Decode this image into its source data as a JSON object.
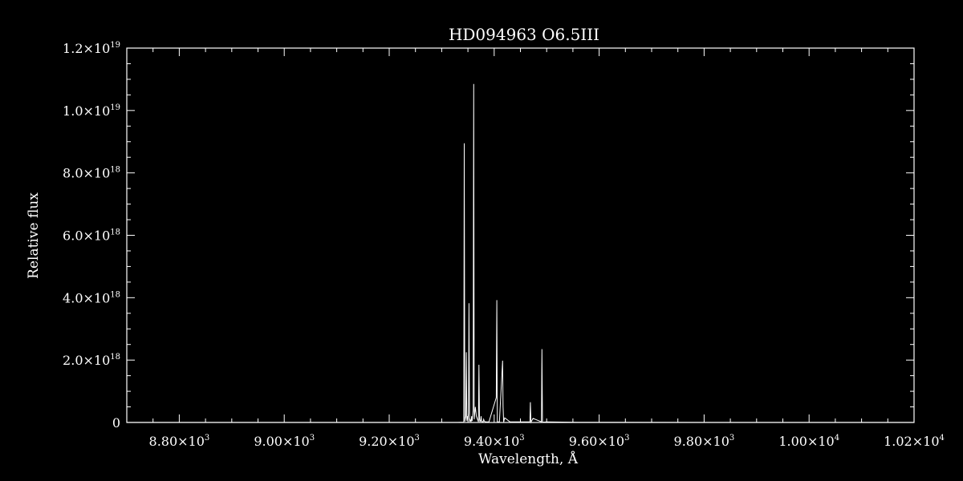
{
  "chart_data": {
    "type": "line",
    "title": "HD094963   O6.5III",
    "xlabel": "Wavelength, Å",
    "ylabel": "Relative flux",
    "xlim": [
      8700,
      10200
    ],
    "ylim": [
      0,
      1.2e+19
    ],
    "x_ticks": [
      {
        "value": 8800,
        "label": "8.80×10",
        "exp": "3"
      },
      {
        "value": 9000,
        "label": "9.00×10",
        "exp": "3"
      },
      {
        "value": 9200,
        "label": "9.20×10",
        "exp": "3"
      },
      {
        "value": 9400,
        "label": "9.40×10",
        "exp": "3"
      },
      {
        "value": 9600,
        "label": "9.60×10",
        "exp": "3"
      },
      {
        "value": 9800,
        "label": "9.80×10",
        "exp": "3"
      },
      {
        "value": 10000,
        "label": "1.00×10",
        "exp": "4"
      },
      {
        "value": 10200,
        "label": "1.02×10",
        "exp": "4"
      }
    ],
    "y_ticks": [
      {
        "value": 0,
        "label": "0",
        "exp": ""
      },
      {
        "value": 2e+18,
        "label": "2.0×10",
        "exp": "18"
      },
      {
        "value": 4e+18,
        "label": "4.0×10",
        "exp": "18"
      },
      {
        "value": 6e+18,
        "label": "6.0×10",
        "exp": "18"
      },
      {
        "value": 8e+18,
        "label": "8.0×10",
        "exp": "18"
      },
      {
        "value": 1e+19,
        "label": "1.0×10",
        "exp": "19"
      },
      {
        "value": 1.2e+19,
        "label": "1.2×10",
        "exp": "19"
      }
    ],
    "series": [
      {
        "color": "#ffffff",
        "x": [
          8700,
          9330,
          9342,
          9343,
          9344,
          9346,
          9347,
          9348,
          9349,
          9350,
          9351,
          9352,
          9353,
          9354,
          9356,
          9357,
          9358,
          9360,
          9361,
          9362,
          9364,
          9366,
          9370,
          9371,
          9372,
          9373,
          9374,
          9375,
          9376,
          9379,
          9380,
          9381,
          9383,
          9390,
          9404,
          9405,
          9406,
          9410,
          9416,
          9417,
          9418,
          9420,
          9430,
          9468,
          9469,
          9470,
          9474,
          9490,
          9491,
          9492,
          9500,
          9560,
          10200
        ],
        "y": [
          2000000000000000.0,
          2000000000000000.0,
          1e+16,
          8.95e+18,
          3e+16,
          2e+17,
          2.25e+18,
          5e+16,
          2e+17,
          1e+17,
          3e+17,
          3.82e+18,
          2e+16,
          1e+17,
          2e+16,
          2e+17,
          5e+16,
          4e+17,
          1.085e+19,
          1e+17,
          5e+17,
          2e+17,
          2e+16,
          1.85e+18,
          1e+17,
          3e+16,
          5e+16,
          2e+17,
          3e+16,
          2e+16,
          1e+17,
          5e+16,
          2e+16,
          2e+16,
          8e+17,
          3.92e+18,
          2e+16,
          2e+16,
          1.98e+18,
          5e+17,
          1e+16,
          1.5e+17,
          2e+16,
          2e+16,
          6.5e+17,
          1e+16,
          1.3e+17,
          2e+16,
          2.35e+18,
          1e+16,
          2e+16,
          5000000000000000.0,
          2000000000000000.0
        ]
      }
    ]
  }
}
